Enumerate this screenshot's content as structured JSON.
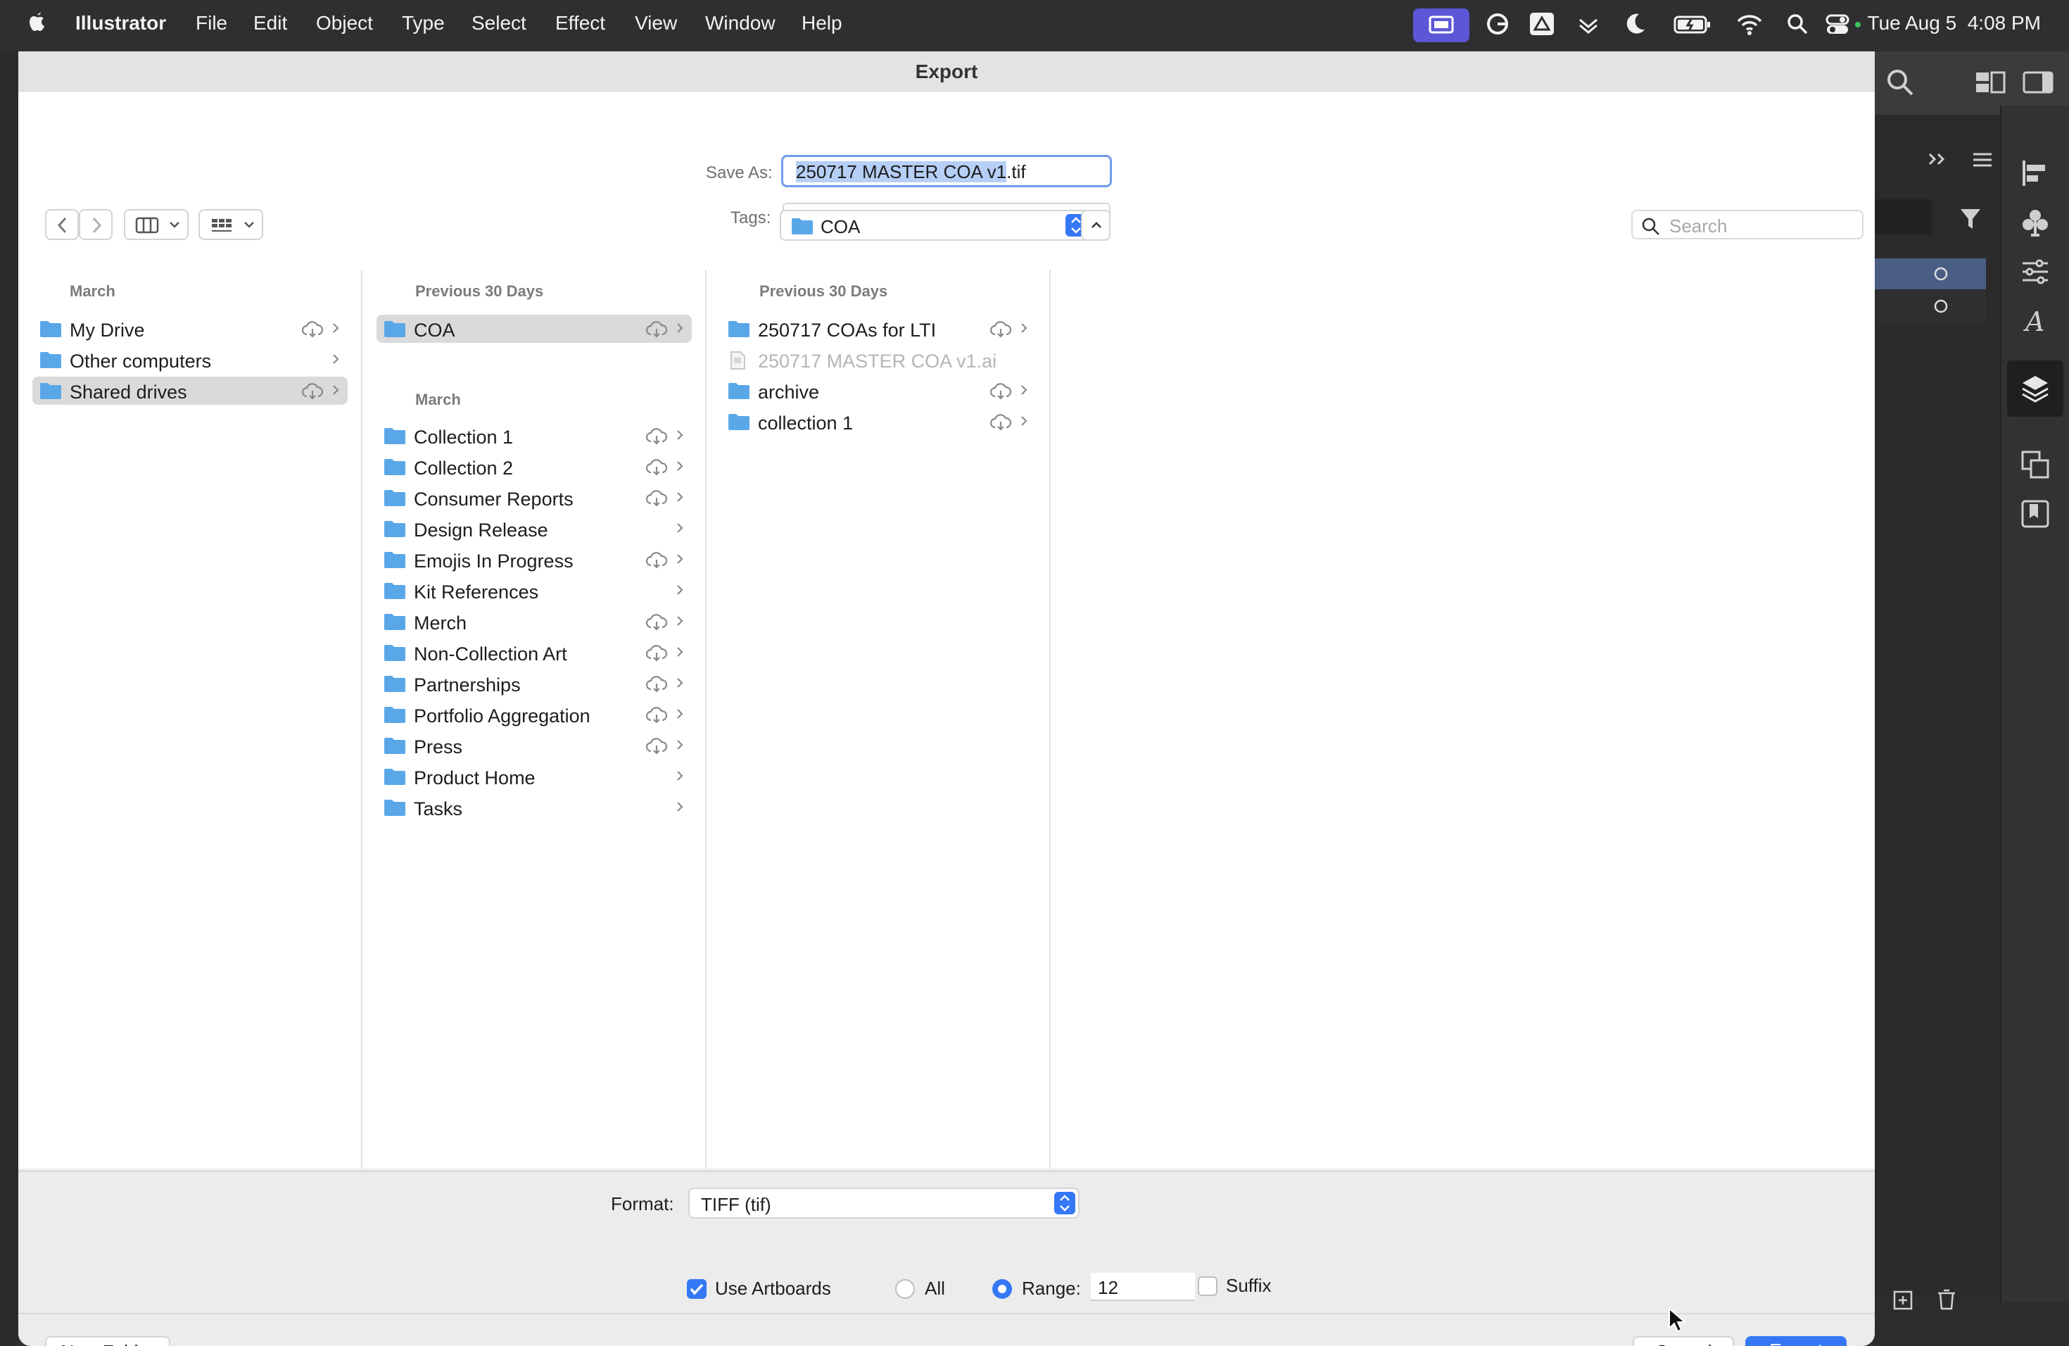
{
  "menubar": {
    "app": "Illustrator",
    "items": [
      "File",
      "Edit",
      "Object",
      "Type",
      "Select",
      "Effect",
      "View",
      "Window",
      "Help"
    ],
    "date": "Tue Aug 5",
    "time": "4:08 PM"
  },
  "dialog": {
    "title": "Export",
    "save_as_label": "Save As:",
    "save_as_selected": "250717 MASTER COA v1",
    "save_as_ext": ".tif",
    "tags_label": "Tags:",
    "location": "COA",
    "search_placeholder": "Search"
  },
  "columns": [
    {
      "header": "March",
      "rows": [
        {
          "label": "My Drive",
          "cloud": true,
          "chevron": true,
          "selected": false
        },
        {
          "label": "Other computers",
          "cloud": false,
          "chevron": true,
          "selected": false
        },
        {
          "label": "Shared drives",
          "cloud": true,
          "chevron": true,
          "selected": true
        }
      ]
    },
    {
      "header": "Previous 30 Days",
      "rows": [
        {
          "label": "COA",
          "cloud": true,
          "chevron": true,
          "selected": true
        }
      ],
      "subheader": "March",
      "subrows": [
        {
          "label": "Collection 1",
          "cloud": true
        },
        {
          "label": "Collection 2",
          "cloud": true
        },
        {
          "label": "Consumer Reports",
          "cloud": true
        },
        {
          "label": "Design Release",
          "cloud": false
        },
        {
          "label": "Emojis In Progress",
          "cloud": true
        },
        {
          "label": "Kit References",
          "cloud": false
        },
        {
          "label": "Merch",
          "cloud": true
        },
        {
          "label": "Non-Collection Art",
          "cloud": true
        },
        {
          "label": "Partnerships",
          "cloud": true
        },
        {
          "label": "Portfolio Aggregation",
          "cloud": true
        },
        {
          "label": "Press",
          "cloud": true
        },
        {
          "label": "Product Home",
          "cloud": false
        },
        {
          "label": "Tasks",
          "cloud": false
        }
      ]
    },
    {
      "header": "Previous 30 Days",
      "rows": [
        {
          "label": "250717 COAs for LTI",
          "cloud": true,
          "chevron": true,
          "type": "folder"
        },
        {
          "label": "250717 MASTER COA v1.ai",
          "cloud": false,
          "chevron": false,
          "type": "file"
        },
        {
          "label": "archive",
          "cloud": true,
          "chevron": true,
          "type": "folder"
        },
        {
          "label": "collection 1",
          "cloud": true,
          "chevron": true,
          "type": "folder"
        }
      ]
    }
  ],
  "bottom": {
    "format_label": "Format:",
    "format_value": "TIFF (tif)",
    "use_artboards_label": "Use Artboards",
    "use_artboards_checked": true,
    "all_label": "All",
    "range_label": "Range:",
    "range_value": "12",
    "range_selected": true,
    "suffix_label": "Suffix",
    "suffix_checked": false,
    "new_folder_label": "New Folder",
    "cancel_label": "Cancel",
    "export_label": "Export"
  },
  "colors": {
    "accent": "#3478f6",
    "folder": "#5aa7e8",
    "selection_row": "#dadada"
  }
}
